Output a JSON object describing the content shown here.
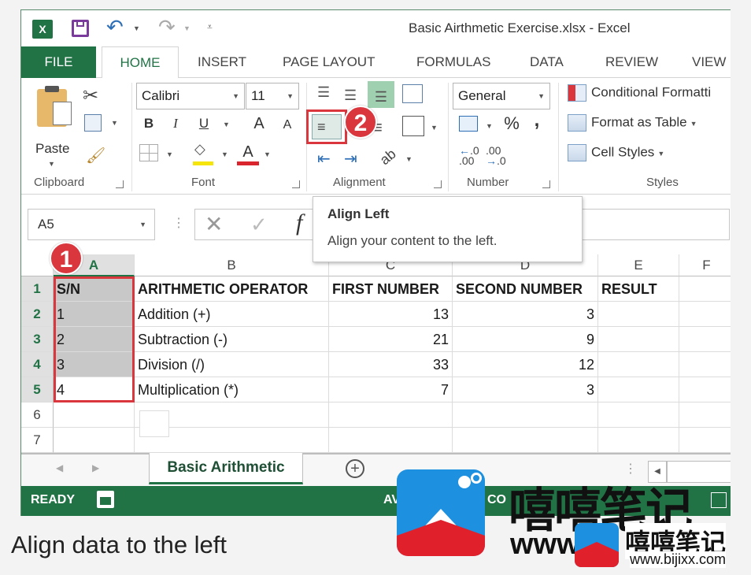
{
  "window": {
    "title": "Basic Airthmetic Exercise.xlsx - Excel"
  },
  "quick_access": {
    "app_icon": "excel-icon",
    "save_icon": "save-icon",
    "undo_icon": "undo-icon",
    "redo_icon": "redo-icon",
    "customize_icon": "customize-toolbar-icon"
  },
  "tabs": [
    {
      "label": "FILE"
    },
    {
      "label": "HOME",
      "active": true
    },
    {
      "label": "INSERT"
    },
    {
      "label": "PAGE LAYOUT"
    },
    {
      "label": "FORMULAS"
    },
    {
      "label": "DATA"
    },
    {
      "label": "REVIEW"
    },
    {
      "label": "VIEW"
    }
  ],
  "ribbon": {
    "clipboard": {
      "label": "Clipboard",
      "paste_label": "Paste"
    },
    "font": {
      "label": "Font",
      "font_name": "Calibri",
      "font_size": "11",
      "bold": "B",
      "italic": "I",
      "underline": "U",
      "grow": "A",
      "shrink": "A",
      "font_color_letter": "A",
      "fill_color": "#f5e50a",
      "font_color": "#d9262e"
    },
    "alignment": {
      "label": "Alignment",
      "align_left_highlighted": true
    },
    "number": {
      "label": "Number",
      "format": "General",
      "percent": "%",
      "comma": ","
    },
    "styles": {
      "label": "Styles",
      "conditional": "Conditional Formatti",
      "format_table": "Format as Table",
      "cell_styles": "Cell Styles"
    }
  },
  "formula_bar": {
    "name_box": "A5",
    "fx": "f",
    "content": ""
  },
  "tooltip": {
    "title": "Align Left",
    "description": "Align your content to the left."
  },
  "badges": {
    "step1": "1",
    "step2": "2"
  },
  "grid": {
    "columns": [
      "A",
      "B",
      "C",
      "D",
      "E",
      "F"
    ],
    "rows": [
      {
        "num": "1",
        "cells": [
          "S/N",
          "ARITHMETIC OPERATOR",
          "FIRST NUMBER",
          "SECOND NUMBER",
          "RESULT",
          ""
        ]
      },
      {
        "num": "2",
        "cells": [
          "1",
          "Addition (+)",
          "13",
          "3",
          "",
          ""
        ]
      },
      {
        "num": "3",
        "cells": [
          "2",
          "Subtraction (-)",
          "21",
          "9",
          "",
          ""
        ]
      },
      {
        "num": "4",
        "cells": [
          "3",
          "Division (/)",
          "33",
          "12",
          "",
          ""
        ]
      },
      {
        "num": "5",
        "cells": [
          "4",
          "Multiplication (*)",
          "7",
          "3",
          "",
          ""
        ]
      },
      {
        "num": "6",
        "cells": [
          "",
          "",
          "",
          "",
          "",
          ""
        ]
      },
      {
        "num": "7",
        "cells": [
          "",
          "",
          "",
          "",
          "",
          ""
        ]
      }
    ],
    "selected_range": "A1:A5"
  },
  "sheets": {
    "active": "Basic Arithmetic",
    "add_icon": "plus-circle-icon"
  },
  "status": {
    "text": "READY",
    "partial_text_1": "AV",
    "partial_text_2": "CO"
  },
  "colors": {
    "excel_green": "#217346",
    "highlight_red": "#d9363e"
  },
  "caption": "Align data to the left",
  "watermark": {
    "brand": "嘻嘻笔记",
    "url": "www.bijixx.com",
    "url_partial": "www"
  }
}
